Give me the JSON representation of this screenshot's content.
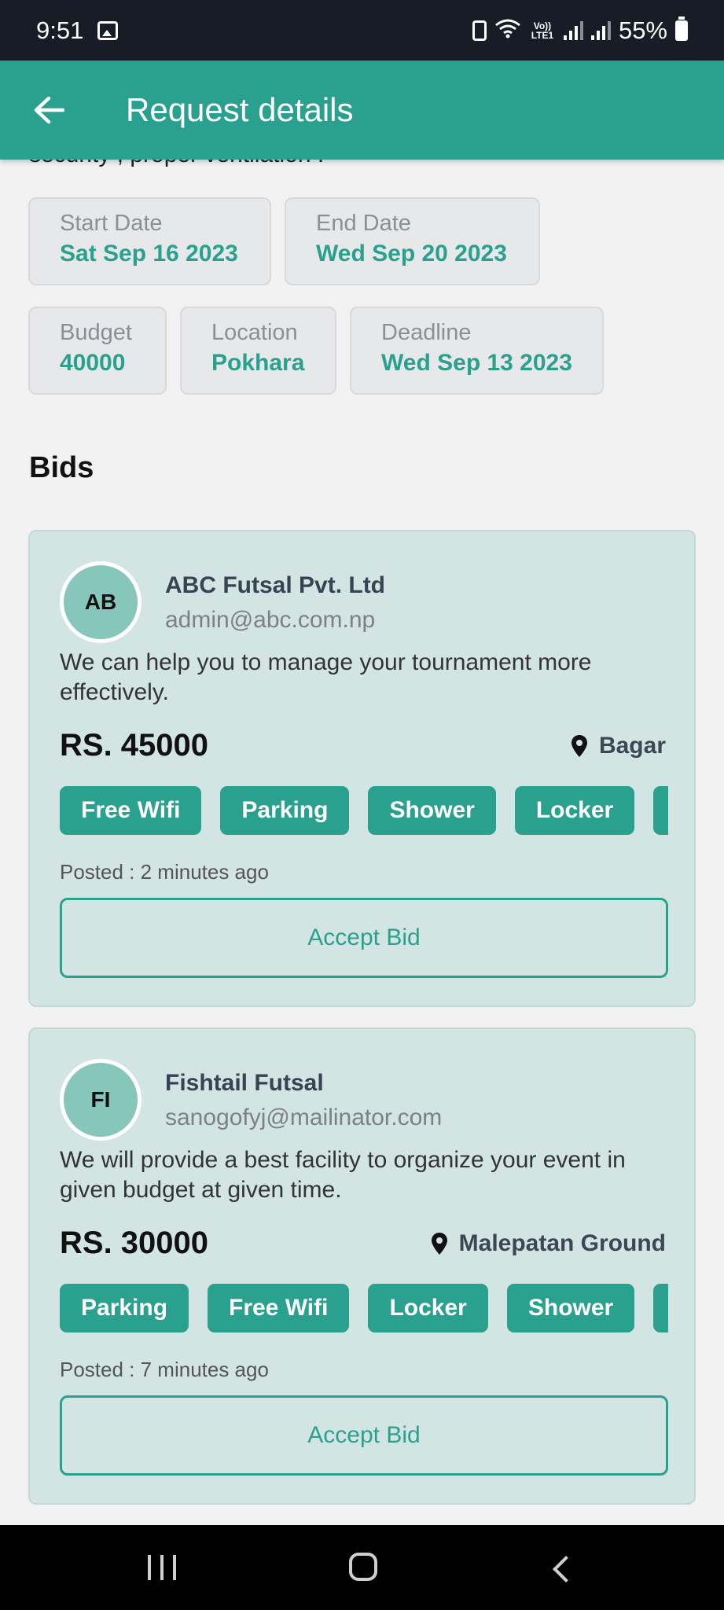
{
  "status_bar": {
    "time": "9:51",
    "lte_label": "Vo)) LTE1",
    "battery": "55%"
  },
  "app_bar": {
    "title": "Request details"
  },
  "clipped_text": "security , proper ventilation .",
  "info": {
    "start_date": {
      "label": "Start Date",
      "value": "Sat Sep 16 2023"
    },
    "end_date": {
      "label": "End Date",
      "value": "Wed Sep 20 2023"
    },
    "budget": {
      "label": "Budget",
      "value": "40000"
    },
    "location": {
      "label": "Location",
      "value": "Pokhara"
    },
    "deadline": {
      "label": "Deadline",
      "value": "Wed Sep 13 2023"
    }
  },
  "bids_title": "Bids",
  "bids": [
    {
      "initials": "AB",
      "name": "ABC Futsal Pvt. Ltd",
      "email": "admin@abc.com.np",
      "message": "We can help you to manage your tournament more effectively.",
      "price": "RS. 45000",
      "location": "Bagar",
      "tags": [
        "Free Wifi",
        "Parking",
        "Shower",
        "Locker",
        ""
      ],
      "posted": "Posted : 2 minutes ago",
      "accept_label": "Accept Bid"
    },
    {
      "initials": "FI",
      "name": "Fishtail Futsal",
      "email": "sanogofyj@mailinator.com",
      "message": "We will provide a best facility to organize your event in given budget at given time.",
      "price": "RS. 30000",
      "location": "Malepatan Ground",
      "tags": [
        "Parking",
        "Free Wifi",
        "Locker",
        "Shower",
        ""
      ],
      "posted": "Posted : 7 minutes ago",
      "accept_label": "Accept Bid"
    }
  ],
  "colors": {
    "primary": "#2aa18e",
    "card_bg": "#d2e5e3",
    "status_bar": "#181c27"
  }
}
